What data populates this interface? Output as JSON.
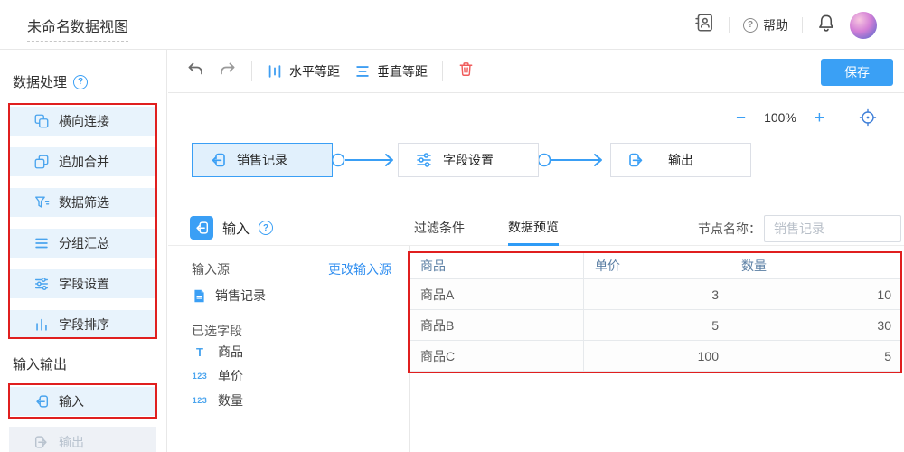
{
  "topbar": {
    "title": "未命名数据视图",
    "help_label": "帮助"
  },
  "sidebar": {
    "section1_title": "数据处理",
    "section2_title": "输入输出",
    "tools": [
      {
        "label": "横向连接"
      },
      {
        "label": "追加合并"
      },
      {
        "label": "数据筛选"
      },
      {
        "label": "分组汇总"
      },
      {
        "label": "字段设置"
      },
      {
        "label": "字段排序"
      }
    ],
    "io": [
      {
        "label": "输入"
      },
      {
        "label": "输出"
      }
    ]
  },
  "toolbar": {
    "h_spacing_label": "水平等距",
    "v_spacing_label": "垂直等距",
    "save_label": "保存"
  },
  "canvas": {
    "zoom_level": "100%",
    "nodes": [
      {
        "label": "销售记录"
      },
      {
        "label": "字段设置"
      },
      {
        "label": "输出"
      }
    ]
  },
  "panel": {
    "title": "输入",
    "tabs": [
      {
        "label": "过滤条件"
      },
      {
        "label": "数据预览"
      }
    ],
    "node_name_label": "节点名称：",
    "node_name_value": "销售记录",
    "source_label": "输入源",
    "change_source_label": "更改输入源",
    "source_name": "销售记录",
    "selected_fields_label": "已选字段",
    "fields": [
      {
        "icon": "T",
        "label": "商品"
      },
      {
        "icon": "123",
        "label": "单价"
      },
      {
        "icon": "123",
        "label": "数量"
      }
    ],
    "table": {
      "headers": [
        "商品",
        "单价",
        "数量"
      ],
      "rows": [
        [
          "商品A",
          "3",
          "10"
        ],
        [
          "商品B",
          "5",
          "30"
        ],
        [
          "商品C",
          "100",
          "5"
        ]
      ]
    }
  },
  "colors": {
    "accent_blue": "#3aa0f5",
    "sidebar_item_bg": "#e8f3fc",
    "annotation_red": "#e01f1f",
    "trash_red": "#f05b5b",
    "table_header_text": "#5b7fa4"
  }
}
